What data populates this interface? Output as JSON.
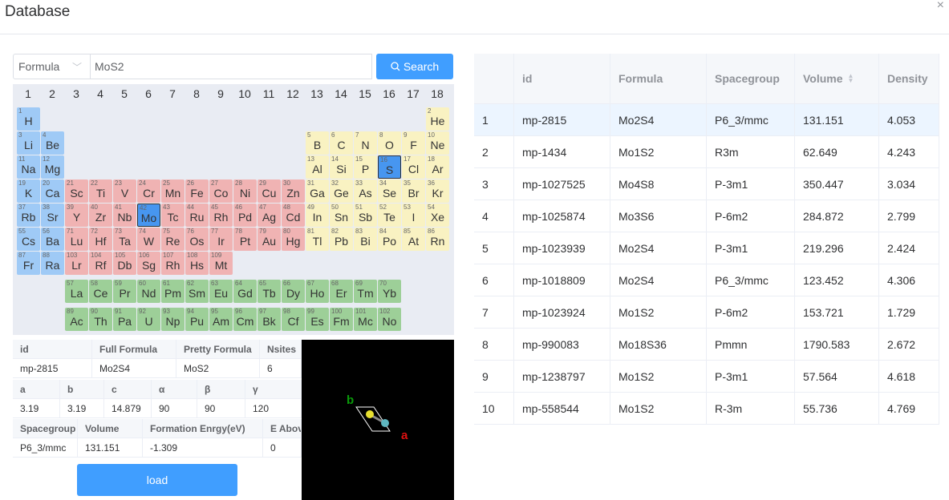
{
  "dialog": {
    "title": "Database",
    "close": "×"
  },
  "search": {
    "mode": "Formula",
    "query": "MoS2",
    "button": "Search"
  },
  "groups": [
    "1",
    "2",
    "3",
    "4",
    "5",
    "6",
    "7",
    "8",
    "9",
    "10",
    "11",
    "12",
    "13",
    "14",
    "15",
    "16",
    "17",
    "18"
  ],
  "elements": [
    {
      "z": 1,
      "s": "H",
      "r": 1,
      "c": 1,
      "t": "alk"
    },
    {
      "z": 2,
      "s": "He",
      "r": 1,
      "c": 18,
      "t": "pm"
    },
    {
      "z": 3,
      "s": "Li",
      "r": 2,
      "c": 1,
      "t": "alk"
    },
    {
      "z": 4,
      "s": "Be",
      "r": 2,
      "c": 2,
      "t": "alk"
    },
    {
      "z": 5,
      "s": "B",
      "r": 2,
      "c": 13,
      "t": "pm"
    },
    {
      "z": 6,
      "s": "C",
      "r": 2,
      "c": 14,
      "t": "pm"
    },
    {
      "z": 7,
      "s": "N",
      "r": 2,
      "c": 15,
      "t": "pm"
    },
    {
      "z": 8,
      "s": "O",
      "r": 2,
      "c": 16,
      "t": "pm"
    },
    {
      "z": 9,
      "s": "F",
      "r": 2,
      "c": 17,
      "t": "pm"
    },
    {
      "z": 10,
      "s": "Ne",
      "r": 2,
      "c": 18,
      "t": "pm"
    },
    {
      "z": 11,
      "s": "Na",
      "r": 3,
      "c": 1,
      "t": "alk"
    },
    {
      "z": 12,
      "s": "Mg",
      "r": 3,
      "c": 2,
      "t": "alk"
    },
    {
      "z": 13,
      "s": "Al",
      "r": 3,
      "c": 13,
      "t": "pm"
    },
    {
      "z": 14,
      "s": "Si",
      "r": 3,
      "c": 14,
      "t": "pm"
    },
    {
      "z": 15,
      "s": "P",
      "r": 3,
      "c": 15,
      "t": "pm"
    },
    {
      "z": 16,
      "s": "S",
      "r": 3,
      "c": 16,
      "t": "sel1"
    },
    {
      "z": 17,
      "s": "Cl",
      "r": 3,
      "c": 17,
      "t": "pm"
    },
    {
      "z": 18,
      "s": "Ar",
      "r": 3,
      "c": 18,
      "t": "pm"
    },
    {
      "z": 19,
      "s": "K",
      "r": 4,
      "c": 1,
      "t": "alk"
    },
    {
      "z": 20,
      "s": "Ca",
      "r": 4,
      "c": 2,
      "t": "alk"
    },
    {
      "z": 21,
      "s": "Sc",
      "r": 4,
      "c": 3,
      "t": "tm"
    },
    {
      "z": 22,
      "s": "Ti",
      "r": 4,
      "c": 4,
      "t": "tm"
    },
    {
      "z": 23,
      "s": "V",
      "r": 4,
      "c": 5,
      "t": "tm"
    },
    {
      "z": 24,
      "s": "Cr",
      "r": 4,
      "c": 6,
      "t": "tm"
    },
    {
      "z": 25,
      "s": "Mn",
      "r": 4,
      "c": 7,
      "t": "tm"
    },
    {
      "z": 26,
      "s": "Fe",
      "r": 4,
      "c": 8,
      "t": "tm"
    },
    {
      "z": 27,
      "s": "Co",
      "r": 4,
      "c": 9,
      "t": "tm"
    },
    {
      "z": 28,
      "s": "Ni",
      "r": 4,
      "c": 10,
      "t": "tm"
    },
    {
      "z": 29,
      "s": "Cu",
      "r": 4,
      "c": 11,
      "t": "tm"
    },
    {
      "z": 30,
      "s": "Zn",
      "r": 4,
      "c": 12,
      "t": "tm"
    },
    {
      "z": 31,
      "s": "Ga",
      "r": 4,
      "c": 13,
      "t": "pm"
    },
    {
      "z": 32,
      "s": "Ge",
      "r": 4,
      "c": 14,
      "t": "pm"
    },
    {
      "z": 33,
      "s": "As",
      "r": 4,
      "c": 15,
      "t": "pm"
    },
    {
      "z": 34,
      "s": "Se",
      "r": 4,
      "c": 16,
      "t": "pm"
    },
    {
      "z": 35,
      "s": "Br",
      "r": 4,
      "c": 17,
      "t": "pm"
    },
    {
      "z": 36,
      "s": "Kr",
      "r": 4,
      "c": 18,
      "t": "pm"
    },
    {
      "z": 37,
      "s": "Rb",
      "r": 5,
      "c": 1,
      "t": "alk"
    },
    {
      "z": 38,
      "s": "Sr",
      "r": 5,
      "c": 2,
      "t": "alk"
    },
    {
      "z": 39,
      "s": "Y",
      "r": 5,
      "c": 3,
      "t": "tm"
    },
    {
      "z": 40,
      "s": "Zr",
      "r": 5,
      "c": 4,
      "t": "tm"
    },
    {
      "z": 41,
      "s": "Nb",
      "r": 5,
      "c": 5,
      "t": "tm"
    },
    {
      "z": 42,
      "s": "Mo",
      "r": 5,
      "c": 6,
      "t": "sel1"
    },
    {
      "z": 43,
      "s": "Tc",
      "r": 5,
      "c": 7,
      "t": "tm"
    },
    {
      "z": 44,
      "s": "Ru",
      "r": 5,
      "c": 8,
      "t": "tm"
    },
    {
      "z": 45,
      "s": "Rh",
      "r": 5,
      "c": 9,
      "t": "tm"
    },
    {
      "z": 46,
      "s": "Pd",
      "r": 5,
      "c": 10,
      "t": "tm"
    },
    {
      "z": 47,
      "s": "Ag",
      "r": 5,
      "c": 11,
      "t": "tm"
    },
    {
      "z": 48,
      "s": "Cd",
      "r": 5,
      "c": 12,
      "t": "tm"
    },
    {
      "z": 49,
      "s": "In",
      "r": 5,
      "c": 13,
      "t": "pm"
    },
    {
      "z": 50,
      "s": "Sn",
      "r": 5,
      "c": 14,
      "t": "pm"
    },
    {
      "z": 51,
      "s": "Sb",
      "r": 5,
      "c": 15,
      "t": "pm"
    },
    {
      "z": 52,
      "s": "Te",
      "r": 5,
      "c": 16,
      "t": "pm"
    },
    {
      "z": 53,
      "s": "I",
      "r": 5,
      "c": 17,
      "t": "pm"
    },
    {
      "z": 54,
      "s": "Xe",
      "r": 5,
      "c": 18,
      "t": "pm"
    },
    {
      "z": 55,
      "s": "Cs",
      "r": 6,
      "c": 1,
      "t": "alk"
    },
    {
      "z": 56,
      "s": "Ba",
      "r": 6,
      "c": 2,
      "t": "alk"
    },
    {
      "z": 71,
      "s": "Lu",
      "r": 6,
      "c": 3,
      "t": "tm"
    },
    {
      "z": 72,
      "s": "Hf",
      "r": 6,
      "c": 4,
      "t": "tm"
    },
    {
      "z": 73,
      "s": "Ta",
      "r": 6,
      "c": 5,
      "t": "tm"
    },
    {
      "z": 74,
      "s": "W",
      "r": 6,
      "c": 6,
      "t": "tm"
    },
    {
      "z": 75,
      "s": "Re",
      "r": 6,
      "c": 7,
      "t": "tm"
    },
    {
      "z": 76,
      "s": "Os",
      "r": 6,
      "c": 8,
      "t": "tm"
    },
    {
      "z": 77,
      "s": "Ir",
      "r": 6,
      "c": 9,
      "t": "tm"
    },
    {
      "z": 78,
      "s": "Pt",
      "r": 6,
      "c": 10,
      "t": "tm"
    },
    {
      "z": 79,
      "s": "Au",
      "r": 6,
      "c": 11,
      "t": "tm"
    },
    {
      "z": 80,
      "s": "Hg",
      "r": 6,
      "c": 12,
      "t": "tm"
    },
    {
      "z": 81,
      "s": "Tl",
      "r": 6,
      "c": 13,
      "t": "pm"
    },
    {
      "z": 82,
      "s": "Pb",
      "r": 6,
      "c": 14,
      "t": "pm"
    },
    {
      "z": 83,
      "s": "Bi",
      "r": 6,
      "c": 15,
      "t": "pm"
    },
    {
      "z": 84,
      "s": "Po",
      "r": 6,
      "c": 16,
      "t": "pm"
    },
    {
      "z": 85,
      "s": "At",
      "r": 6,
      "c": 17,
      "t": "pm"
    },
    {
      "z": 86,
      "s": "Rn",
      "r": 6,
      "c": 18,
      "t": "pm"
    },
    {
      "z": 87,
      "s": "Fr",
      "r": 7,
      "c": 1,
      "t": "alk"
    },
    {
      "z": 88,
      "s": "Ra",
      "r": 7,
      "c": 2,
      "t": "alk"
    },
    {
      "z": 103,
      "s": "Lr",
      "r": 7,
      "c": 3,
      "t": "tm"
    },
    {
      "z": 104,
      "s": "Rf",
      "r": 7,
      "c": 4,
      "t": "tm"
    },
    {
      "z": 105,
      "s": "Db",
      "r": 7,
      "c": 5,
      "t": "tm"
    },
    {
      "z": 106,
      "s": "Sg",
      "r": 7,
      "c": 6,
      "t": "tm"
    },
    {
      "z": 107,
      "s": "Rh",
      "r": 7,
      "c": 7,
      "t": "tm"
    },
    {
      "z": 108,
      "s": "Hs",
      "r": 7,
      "c": 8,
      "t": "tm"
    },
    {
      "z": 109,
      "s": "Mt",
      "r": 7,
      "c": 9,
      "t": "tm"
    },
    {
      "z": 57,
      "s": "La",
      "r": 8,
      "c": 3,
      "t": "lan"
    },
    {
      "z": 58,
      "s": "Ce",
      "r": 8,
      "c": 4,
      "t": "lan"
    },
    {
      "z": 59,
      "s": "Pr",
      "r": 8,
      "c": 5,
      "t": "lan"
    },
    {
      "z": 60,
      "s": "Nd",
      "r": 8,
      "c": 6,
      "t": "lan"
    },
    {
      "z": 61,
      "s": "Pm",
      "r": 8,
      "c": 7,
      "t": "lan"
    },
    {
      "z": 62,
      "s": "Sm",
      "r": 8,
      "c": 8,
      "t": "lan"
    },
    {
      "z": 63,
      "s": "Eu",
      "r": 8,
      "c": 9,
      "t": "lan"
    },
    {
      "z": 64,
      "s": "Gd",
      "r": 8,
      "c": 10,
      "t": "lan"
    },
    {
      "z": 65,
      "s": "Tb",
      "r": 8,
      "c": 11,
      "t": "lan"
    },
    {
      "z": 66,
      "s": "Dy",
      "r": 8,
      "c": 12,
      "t": "lan"
    },
    {
      "z": 67,
      "s": "Ho",
      "r": 8,
      "c": 13,
      "t": "lan"
    },
    {
      "z": 68,
      "s": "Er",
      "r": 8,
      "c": 14,
      "t": "lan"
    },
    {
      "z": 69,
      "s": "Tm",
      "r": 8,
      "c": 15,
      "t": "lan"
    },
    {
      "z": 70,
      "s": "Yb",
      "r": 8,
      "c": 16,
      "t": "lan"
    },
    {
      "z": 89,
      "s": "Ac",
      "r": 9,
      "c": 3,
      "t": "lan"
    },
    {
      "z": 90,
      "s": "Th",
      "r": 9,
      "c": 4,
      "t": "lan"
    },
    {
      "z": 91,
      "s": "Pa",
      "r": 9,
      "c": 5,
      "t": "lan"
    },
    {
      "z": 92,
      "s": "U",
      "r": 9,
      "c": 6,
      "t": "lan"
    },
    {
      "z": 93,
      "s": "Np",
      "r": 9,
      "c": 7,
      "t": "lan"
    },
    {
      "z": 94,
      "s": "Pu",
      "r": 9,
      "c": 8,
      "t": "lan"
    },
    {
      "z": 95,
      "s": "Am",
      "r": 9,
      "c": 9,
      "t": "lan"
    },
    {
      "z": 96,
      "s": "Cm",
      "r": 9,
      "c": 10,
      "t": "lan"
    },
    {
      "z": 97,
      "s": "Bk",
      "r": 9,
      "c": 11,
      "t": "lan"
    },
    {
      "z": 98,
      "s": "Cf",
      "r": 9,
      "c": 12,
      "t": "lan"
    },
    {
      "z": 99,
      "s": "Es",
      "r": 9,
      "c": 13,
      "t": "lan"
    },
    {
      "z": 100,
      "s": "Fm",
      "r": 9,
      "c": 14,
      "t": "lan"
    },
    {
      "z": 101,
      "s": "Mc",
      "r": 9,
      "c": 15,
      "t": "lan"
    },
    {
      "z": 102,
      "s": "No",
      "r": 9,
      "c": 16,
      "t": "lan"
    }
  ],
  "details": {
    "r1_head": [
      "id",
      "Full Formula",
      "Pretty Formula",
      "Nsites"
    ],
    "r1_val": [
      "mp-2815",
      "Mo2S4",
      "MoS2",
      "6"
    ],
    "r2_head": [
      "a",
      "b",
      "c",
      "α",
      "β",
      "γ"
    ],
    "r2_val": [
      "3.19",
      "3.19",
      "14.879",
      "90",
      "90",
      "120"
    ],
    "r3_head": [
      "Spacegroup",
      "Volume",
      "Formation Enrgy(eV)",
      "E Above Hull"
    ],
    "r3_val": [
      "P6_3/mmc",
      "131.151",
      "-1.309",
      "0"
    ]
  },
  "viewer": {
    "axis_a": "a",
    "axis_b": "b"
  },
  "load_button": "load",
  "results": {
    "columns": [
      "",
      "id",
      "Formula",
      "Spacegroup",
      "Volume",
      "Density"
    ],
    "rows": [
      [
        "1",
        "mp-2815",
        "Mo2S4",
        "P6_3/mmc",
        "131.151",
        "4.053"
      ],
      [
        "2",
        "mp-1434",
        "Mo1S2",
        "R3m",
        "62.649",
        "4.243"
      ],
      [
        "3",
        "mp-1027525",
        "Mo4S8",
        "P-3m1",
        "350.447",
        "3.034"
      ],
      [
        "4",
        "mp-1025874",
        "Mo3S6",
        "P-6m2",
        "284.872",
        "2.799"
      ],
      [
        "5",
        "mp-1023939",
        "Mo2S4",
        "P-3m1",
        "219.296",
        "2.424"
      ],
      [
        "6",
        "mp-1018809",
        "Mo2S4",
        "P6_3/mmc",
        "123.452",
        "4.306"
      ],
      [
        "7",
        "mp-1023924",
        "Mo1S2",
        "P-6m2",
        "153.721",
        "1.729"
      ],
      [
        "8",
        "mp-990083",
        "Mo18S36",
        "Pmmn",
        "1790.583",
        "2.672"
      ],
      [
        "9",
        "mp-1238797",
        "Mo1S2",
        "P-3m1",
        "57.564",
        "4.618"
      ],
      [
        "10",
        "mp-558544",
        "Mo1S2",
        "R-3m",
        "55.736",
        "4.769"
      ]
    ]
  }
}
